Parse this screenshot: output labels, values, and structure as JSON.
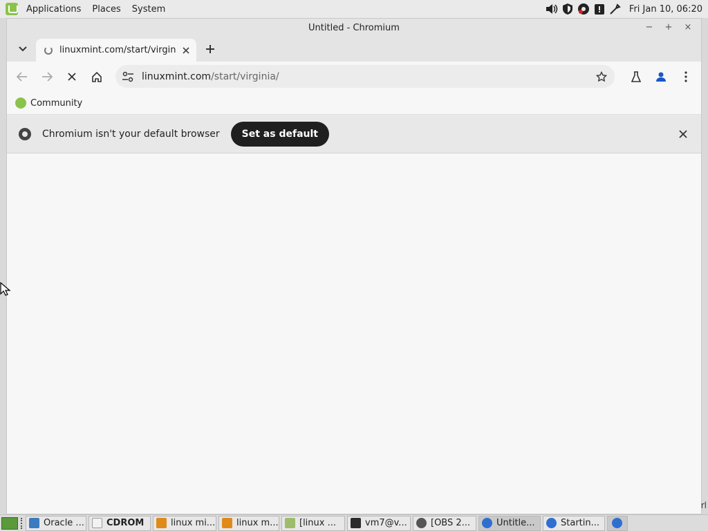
{
  "top_panel": {
    "menus": [
      "Applications",
      "Places",
      "System"
    ],
    "clock": "Fri Jan 10, 06:20"
  },
  "window": {
    "title": "Untitled - Chromium",
    "controls": {
      "minimize": "−",
      "maximize": "+",
      "close": "×"
    }
  },
  "tab": {
    "title": "linuxmint.com/start/virginia/"
  },
  "omnibox": {
    "domain": "linuxmint.com",
    "path": "/start/virginia/"
  },
  "bookmarks": [
    "Community"
  ],
  "infobar": {
    "message": "Chromium isn't your default browser",
    "button": "Set as default"
  },
  "edge_text": "rl",
  "taskbar": {
    "tasks": [
      {
        "label": "Oracle ...",
        "icon_color": "#3b7bbf"
      },
      {
        "label": "CDROM",
        "icon_color": "#f2f2f2"
      },
      {
        "label": "linux mi...",
        "icon_color": "#e08a1a"
      },
      {
        "label": "linux m...",
        "icon_color": "#e08a1a"
      },
      {
        "label": "[linux ...",
        "icon_color": "#9dbd6a"
      },
      {
        "label": "vm7@v...",
        "icon_color": "#2b2b2b"
      },
      {
        "label": "[OBS 2...",
        "icon_color": "#555555"
      },
      {
        "label": "Untitle...",
        "icon_color": "#2f6fd0"
      },
      {
        "label": "Startin...",
        "icon_color": "#2f6fd0"
      }
    ]
  }
}
